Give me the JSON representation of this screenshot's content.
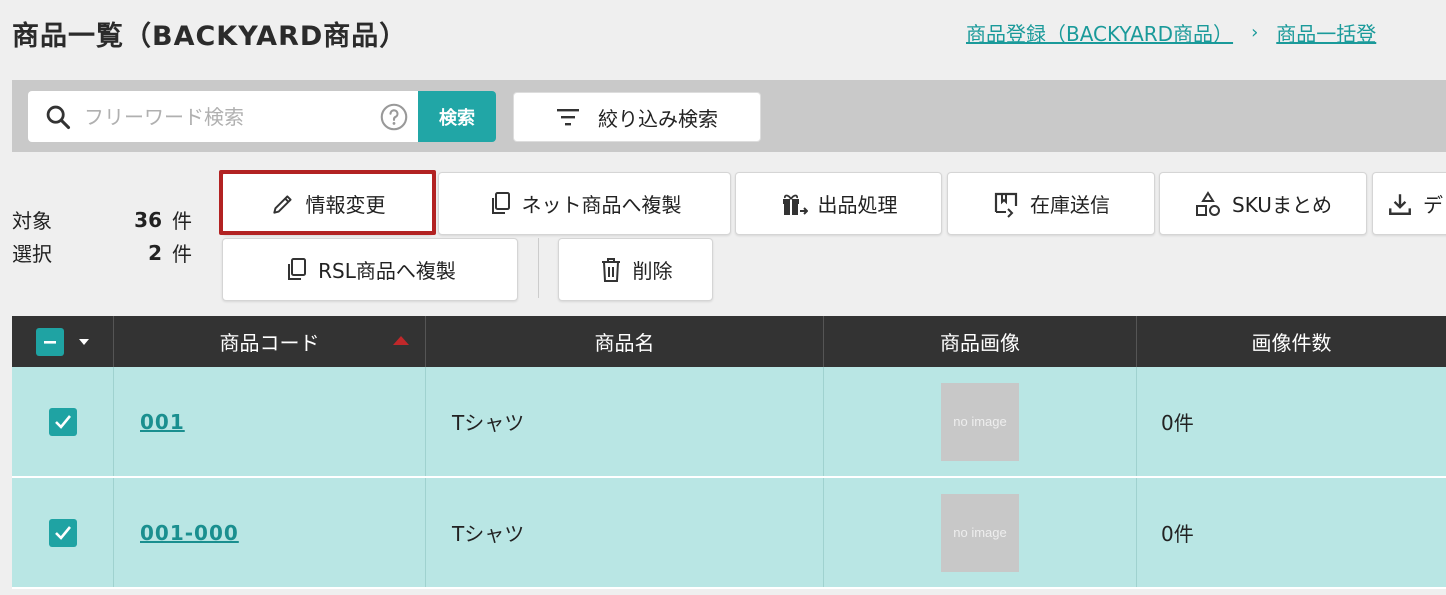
{
  "page_title": "商品一覧（BACKYARD商品）",
  "breadcrumb": {
    "link1": "商品登録（BACKYARD商品）",
    "separator": "›",
    "link2": "商品一括登"
  },
  "search": {
    "placeholder": "フリーワード検索",
    "button_label": "検索",
    "filter_label": "絞り込み検索"
  },
  "counts": {
    "target_label": "対象",
    "target_value": "36",
    "selected_label": "選択",
    "selected_value": "2",
    "unit": "件"
  },
  "toolbar": {
    "edit_info": "情報変更",
    "copy_net": "ネット商品へ複製",
    "listing": "出品処理",
    "stock_send": "在庫送信",
    "sku_merge": "SKUまとめ",
    "download": "デ",
    "copy_rsl": "RSL商品へ複製",
    "delete": "削除"
  },
  "table": {
    "headers": {
      "code": "商品コード",
      "name": "商品名",
      "image": "商品画像",
      "image_count": "画像件数"
    },
    "rows": [
      {
        "code": "001",
        "name": "Tシャツ",
        "image": "no image",
        "image_count": "0件",
        "checked": true
      },
      {
        "code": "001-000",
        "name": "Tシャツ",
        "image": "no image",
        "image_count": "0件",
        "checked": true
      }
    ]
  },
  "colors": {
    "accent": "#21a6a6",
    "row_selected": "#b9e6e4",
    "header_bg": "#333333",
    "highlight": "#b22222"
  }
}
